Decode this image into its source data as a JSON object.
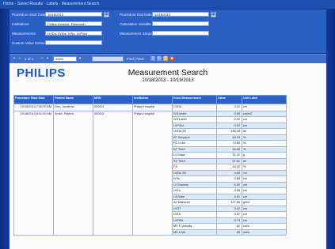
{
  "breadcrumb": "Home · Saved Results · Labels · Measurement Search",
  "filters": {
    "procedure_start_date_label": "Procedure Start Date",
    "procedure_start_date_value": "10/18/2013",
    "procedure_end_date_label": "Procedure End Date",
    "procedure_end_date_value": "10/19/2013",
    "institutions_label": "Institutions",
    "institutions_value": "Philips Hospital, Pittsburgh",
    "calculation_variable_label": "Calculation Variable",
    "calculation_variable_value": "",
    "measurements_label": "Measurements",
    "measurements_value": "LVIDd, LVIDs, IVSd, LVPWd",
    "measurement_sequence_label": "Measurement Sequence",
    "measurement_sequence_value": "",
    "custom_value_extract_label": "Custom Value Extract",
    "custom_value_extract_value": ""
  },
  "toolbar": {
    "page_text": "1 of 1",
    "zoom_value": "100%",
    "find_text": "Find | Next"
  },
  "report": {
    "logo": "PHILIPS",
    "title": "Measurement Search",
    "date_range": "10/18/2013 - 10/19/2013",
    "page_note": "",
    "headers": [
      "Procedure Start Date",
      "Patient Name",
      "MRN",
      "Institution",
      "Echo Measurement",
      "Value",
      "Unit Label"
    ]
  },
  "records": [
    {
      "date": "10/18/2013 7:52:00 AM",
      "patient": "Doe, Jonathan",
      "mrn": "000001",
      "institution": "Philips Hospital"
    },
    {
      "date": "10/18/2013 8:51:00 AM",
      "patient": "Smith, Patient",
      "mrn": "000002",
      "institution": "Philips Hospital"
    }
  ],
  "measurements": [
    {
      "name": "LVIDd",
      "value": "4.41",
      "unit": "cm"
    },
    {
      "name": "IVS Index",
      "value": "0.90",
      "unit": "cm/m2"
    },
    {
      "name": "IVS Label",
      "value": "0.92",
      "unit": "cm"
    },
    {
      "name": "LVPWd",
      "value": "0.92",
      "unit": "cm"
    },
    {
      "name": "LVIDd 2D",
      "value": "165.18",
      "unit": "ml"
    },
    {
      "name": "EF Simpson",
      "value": "60.03",
      "unit": "%"
    },
    {
      "name": "FS Cube",
      "value": "70.66",
      "unit": "%"
    },
    {
      "name": "EF Teich",
      "value": "46.65",
      "unit": "%"
    },
    {
      "name": "LV Mass",
      "value": "31.19",
      "unit": "g"
    },
    {
      "name": "SV Teich",
      "value": "57.61",
      "unit": "ml"
    },
    {
      "name": "FS",
      "value": "16.22",
      "unit": "%"
    },
    {
      "name": "LVIDs 2D",
      "value": "4.59",
      "unit": "cm"
    },
    {
      "name": "IVSs",
      "value": "0.88",
      "unit": "cm"
    },
    {
      "name": "LV Diastole",
      "value": "6.50",
      "unit": "cm"
    },
    {
      "name": "LVEs",
      "value": "4.65",
      "unit": "cm"
    },
    {
      "name": "LA Diam",
      "value": "4.91",
      "unit": "cm"
    },
    {
      "name": "Ao Diameter",
      "value": "137.85",
      "unit": "g/m2"
    },
    {
      "name": "LVOT",
      "value": "3.42",
      "unit": "cm"
    },
    {
      "name": "LVEs",
      "value": "3.87",
      "unit": "cm"
    },
    {
      "name": "LVPWs",
      "value": "0.73",
      "unit": "cm"
    },
    {
      "name": "MV E Velocity",
      "value": "62",
      "unit": "cm/s"
    },
    {
      "name": "MV A Vel",
      "value": "85",
      "unit": "cm/s"
    }
  ],
  "colors": {
    "accent": "#2b60c6",
    "background": "#0f2f86",
    "logo": "#1a56c8"
  }
}
